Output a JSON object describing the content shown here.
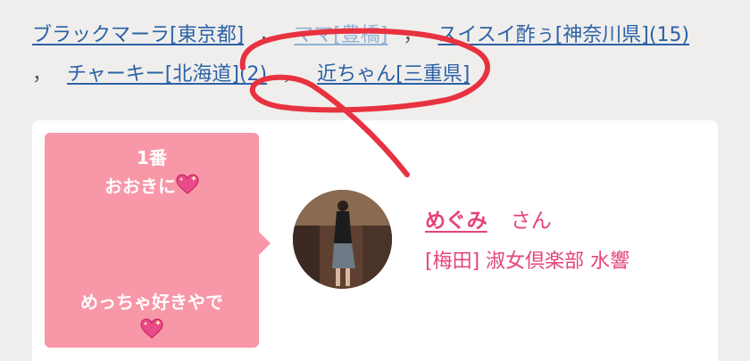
{
  "links": [
    "ブラックマーラ[東京都]",
    "ママ[豊橋]",
    "スイスイ酢ぅ[神奈川県](15)",
    "チャーキー[北海道](2)",
    "近ちゃん[三重県]"
  ],
  "separator": "，",
  "card": {
    "rank": "1番",
    "message_line1": "おおきに",
    "message_line2": "めっちゃ好きやで",
    "name": "めぐみ",
    "honorific": "さん",
    "shop": "[梅田] 淑女倶楽部 水響"
  },
  "icons": {
    "heart": "sparkling-heart-icon"
  },
  "colors": {
    "link": "#2b62a6",
    "pink": "#e6427e",
    "bubble": "#f797a8",
    "scribble": "#e8323f",
    "background": "#f0eeec"
  }
}
